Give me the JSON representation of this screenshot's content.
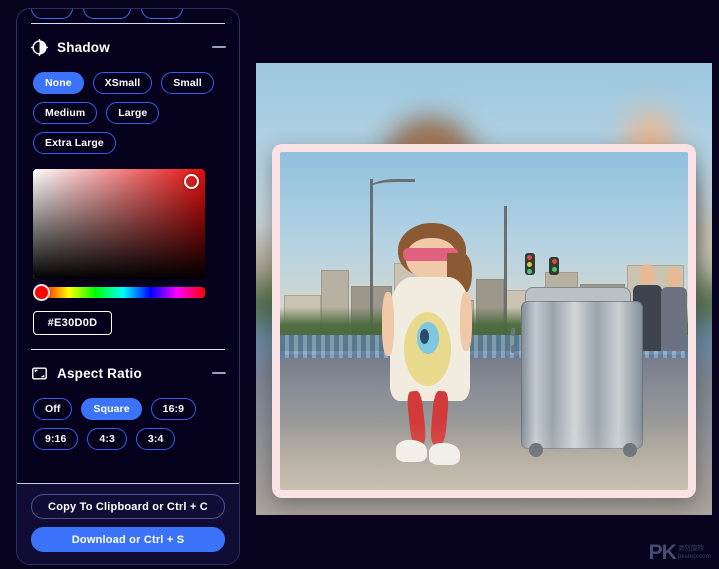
{
  "app": {
    "background_color": "#07021e",
    "panel_background": "#05001c",
    "accent_color": "#3b74fb",
    "frame_color": "#fbe2e4"
  },
  "panel": {
    "sections": [
      {
        "id": "shadow",
        "icon": "contrast-icon",
        "title": "Shadow",
        "collapse_label": "–",
        "options": [
          {
            "label": "None",
            "active": true
          },
          {
            "label": "XSmall",
            "active": false
          },
          {
            "label": "Small",
            "active": false
          },
          {
            "label": "Medium",
            "active": false
          },
          {
            "label": "Large",
            "active": false
          },
          {
            "label": "Extra Large",
            "active": false
          }
        ],
        "color_picker": {
          "hex_value": "#E30D0D",
          "selected_color": "#E30D0D",
          "saturation_handle": "top-right",
          "hue_handle": "left"
        }
      },
      {
        "id": "aspect-ratio",
        "icon": "crop-frame-icon",
        "title": "Aspect Ratio",
        "collapse_label": "–",
        "options": [
          {
            "label": "Off",
            "active": false
          },
          {
            "label": "Square",
            "active": true
          },
          {
            "label": "16:9",
            "active": false
          },
          {
            "label": "9:16",
            "active": false
          },
          {
            "label": "4:3",
            "active": false
          },
          {
            "label": "3:4",
            "active": false
          }
        ]
      }
    ],
    "footer": {
      "copy_label": "Copy To Clipboard or Ctrl + C",
      "download_label": "Download or Ctrl + S"
    }
  },
  "canvas": {
    "description": "Photo of a young girl in pink sunglasses and a printed white dress with red pants and white sneakers, standing on a bridge road next to a large silver hard-shell suitcase, city skyline blurred behind",
    "frame_style": "pink rounded border",
    "background_style": "blurred duplicate of the photo"
  },
  "watermark": {
    "logo": "PK",
    "line1": "请勿旋转",
    "line2": "pkstep.com"
  }
}
